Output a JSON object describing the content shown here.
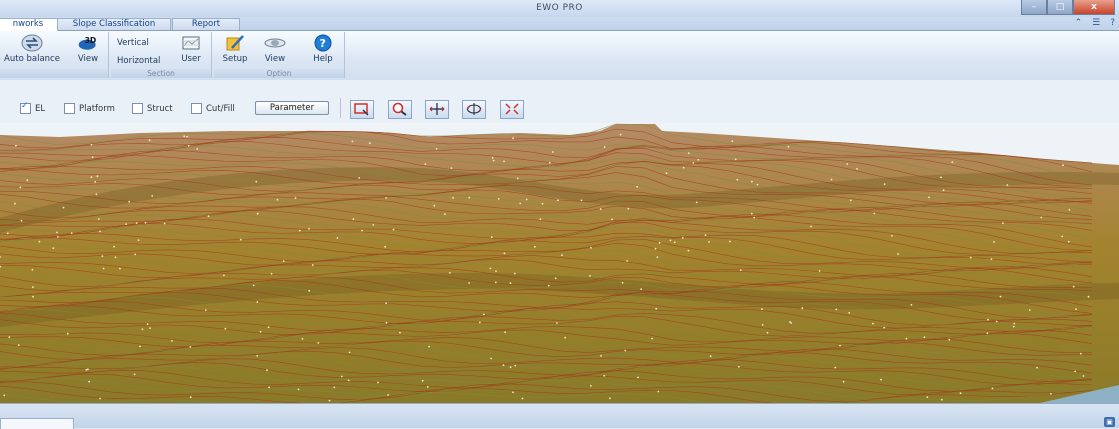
{
  "app": {
    "title": "EWO PRO"
  },
  "tabs": [
    {
      "label": "nworks",
      "active": true
    },
    {
      "label": "Slope Classification",
      "active": false
    },
    {
      "label": "Report",
      "active": false
    }
  ],
  "ribbon": {
    "groups": [
      {
        "label": "",
        "buttons": [
          {
            "label": "Auto balance",
            "icon": "auto-balance-icon"
          },
          {
            "label": "View",
            "icon": "3d-view-icon",
            "badge": "3D"
          }
        ]
      },
      {
        "label": "Section",
        "buttons": [
          {
            "label": "Vertical"
          },
          {
            "label": "Horizontal"
          },
          {
            "label": "User",
            "icon": "user-section-icon"
          }
        ]
      },
      {
        "label": "Option",
        "buttons": [
          {
            "label": "Setup",
            "icon": "setup-icon"
          },
          {
            "label": "View",
            "icon": "view-options-icon"
          },
          {
            "label": "Help",
            "icon": "help-icon",
            "glyph": "?"
          }
        ]
      }
    ]
  },
  "toolstrip": {
    "checkboxes": [
      {
        "label": "EL",
        "checked": true
      },
      {
        "label": "Platform",
        "checked": false
      },
      {
        "label": "Struct",
        "checked": false
      },
      {
        "label": "Cut/Fill",
        "checked": false
      }
    ],
    "parameter_label": "Parameter",
    "view_tools": [
      {
        "name": "zoom-window-icon"
      },
      {
        "name": "zoom-icon"
      },
      {
        "name": "pan-icon"
      },
      {
        "name": "rotate-icon"
      },
      {
        "name": "fit-extents-icon"
      }
    ]
  },
  "window_controls": {
    "minimize": "–",
    "maximize": "□",
    "close": "x"
  },
  "colors": {
    "terrain_light": "#b48a52",
    "terrain_dark": "#6f5a22",
    "contour_red": "#a33a1c",
    "contour_green": "#7f8c3c",
    "ribbon_text": "#1e395b",
    "sky": "#eef3f7"
  }
}
